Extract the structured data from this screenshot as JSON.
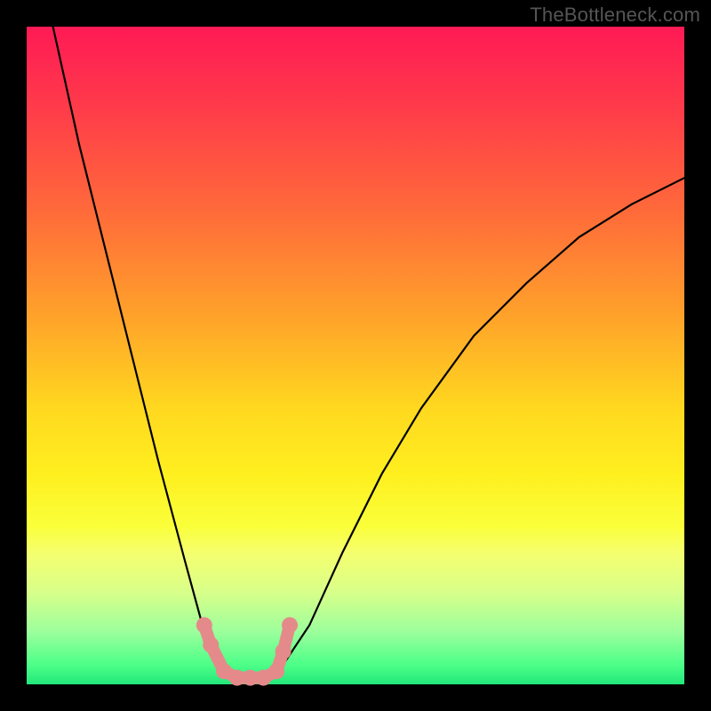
{
  "watermark": {
    "text": "TheBottleneck.com"
  },
  "chart_data": {
    "type": "line",
    "title": "",
    "xlabel": "",
    "ylabel": "",
    "xlim": [
      0,
      100
    ],
    "ylim": [
      0,
      100
    ],
    "background_gradient": [
      "#ff1a55",
      "#ff3a4a",
      "#ff6a3a",
      "#ffa22a",
      "#ffd81f",
      "#ffef1f",
      "#faff3a",
      "#f5ff6e",
      "#d8ff8a",
      "#9cff9c",
      "#4dff88",
      "#22e77a"
    ],
    "series": [
      {
        "name": "bottleneck-curve",
        "stroke": "#000000",
        "points": [
          {
            "x": 4,
            "y": 100
          },
          {
            "x": 8,
            "y": 82
          },
          {
            "x": 12,
            "y": 66
          },
          {
            "x": 16,
            "y": 50
          },
          {
            "x": 20,
            "y": 34
          },
          {
            "x": 24,
            "y": 19
          },
          {
            "x": 27,
            "y": 8
          },
          {
            "x": 30,
            "y": 3
          },
          {
            "x": 33,
            "y": 1
          },
          {
            "x": 36,
            "y": 1
          },
          {
            "x": 39,
            "y": 3
          },
          {
            "x": 43,
            "y": 9
          },
          {
            "x": 48,
            "y": 20
          },
          {
            "x": 54,
            "y": 32
          },
          {
            "x": 60,
            "y": 42
          },
          {
            "x": 68,
            "y": 53
          },
          {
            "x": 76,
            "y": 61
          },
          {
            "x": 84,
            "y": 68
          },
          {
            "x": 92,
            "y": 73
          },
          {
            "x": 100,
            "y": 77
          }
        ]
      },
      {
        "name": "valley-markers",
        "stroke": "#e58a8a",
        "marker_radius": 9,
        "points": [
          {
            "x": 27,
            "y": 9
          },
          {
            "x": 28,
            "y": 6
          },
          {
            "x": 30,
            "y": 2
          },
          {
            "x": 32,
            "y": 1
          },
          {
            "x": 34,
            "y": 1
          },
          {
            "x": 36,
            "y": 1
          },
          {
            "x": 38,
            "y": 2
          },
          {
            "x": 39,
            "y": 5
          },
          {
            "x": 40,
            "y": 9
          }
        ]
      }
    ]
  }
}
